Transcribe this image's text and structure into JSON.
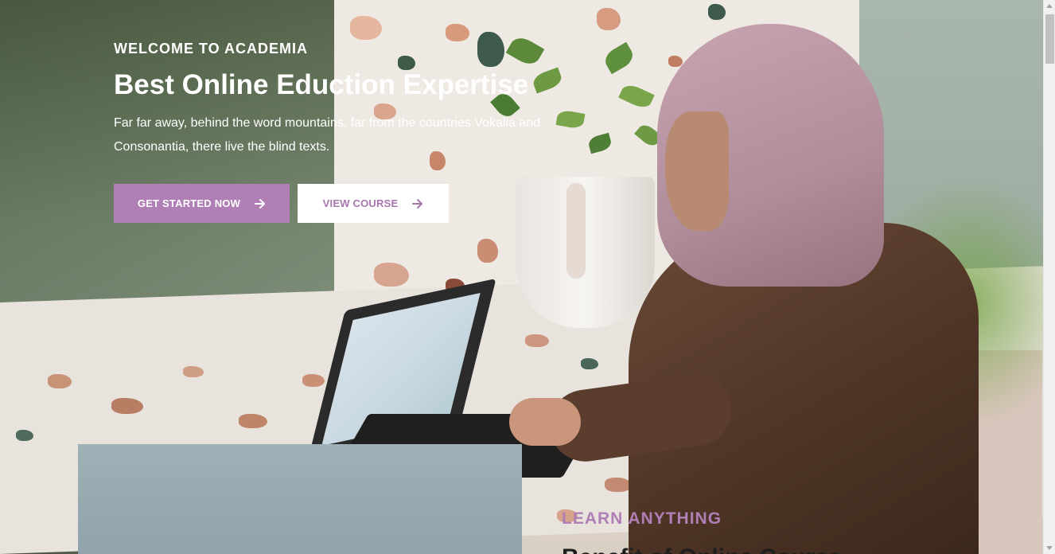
{
  "hero": {
    "eyebrow": "WELCOME TO ACADEMIA",
    "title": "Best Online Eduction Expertise",
    "text": "Far far away, behind the word mountains, far from the countries Vokalia and Consonantia, there live the blind texts.",
    "buttons": {
      "primary_label": "GET STARTED NOW",
      "secondary_label": "VIEW COURSE",
      "icon": "arrow-right-icon"
    }
  },
  "about": {
    "eyebrow": "LEARN ANYTHING",
    "heading": "Benefit of Online Course"
  },
  "colors": {
    "accent": "#b07fb6",
    "accent_text": "#a776ad",
    "white": "#ffffff"
  }
}
